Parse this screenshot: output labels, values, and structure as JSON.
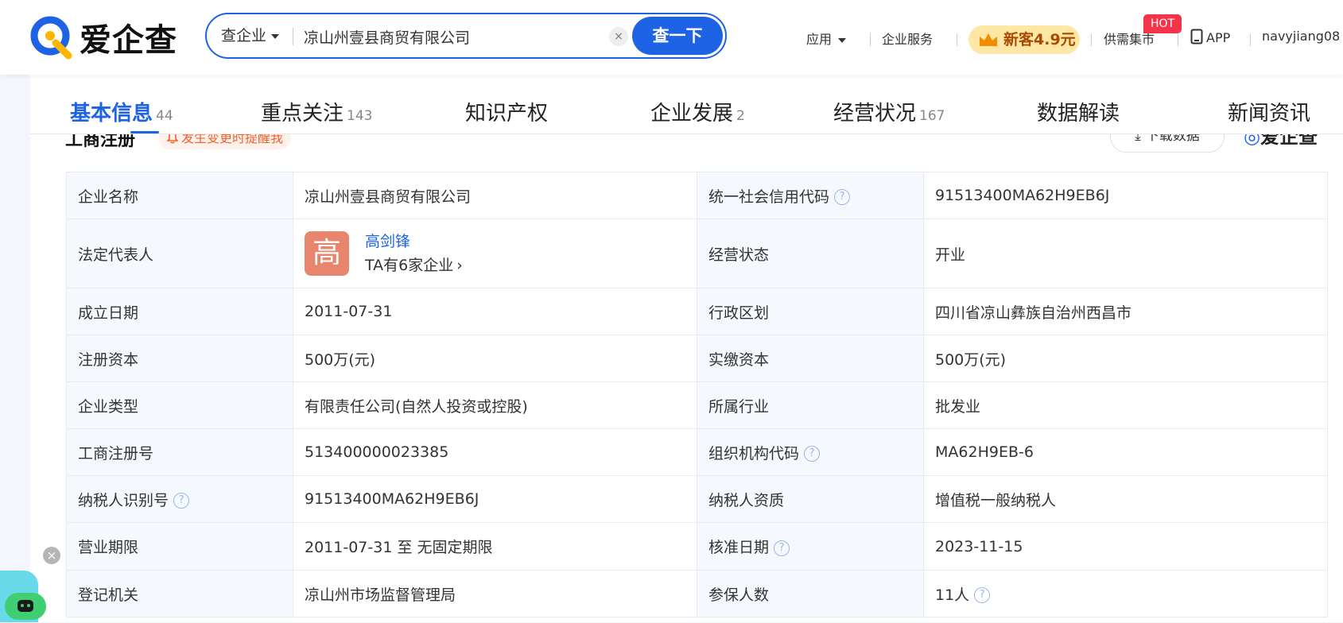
{
  "header": {
    "logo_text": "爱企查",
    "search": {
      "type_label": "查企业",
      "value": "凉山州壹县商贸有限公司",
      "clear_symbol": "×",
      "button_label": "查一下"
    },
    "nav": {
      "apps": "应用",
      "enterprise_services": "企业服务",
      "promo": "新客4.9元",
      "marketplace": "供需集市",
      "hot_badge": "HOT",
      "app": "APP",
      "user": "navyjiang08"
    }
  },
  "tabs": [
    {
      "label": "基本信息",
      "count": "44"
    },
    {
      "label": "重点关注",
      "count": "143"
    },
    {
      "label": "知识产权",
      "count": ""
    },
    {
      "label": "企业发展",
      "count": "2"
    },
    {
      "label": "经营状况",
      "count": "167"
    },
    {
      "label": "数据解读",
      "count": ""
    },
    {
      "label": "新闻资讯",
      "count": ""
    }
  ],
  "section": {
    "title": "工商注册",
    "remind": "发生变更时提醒我",
    "download": "下载数据",
    "watermark": "爱企查"
  },
  "info": {
    "company_name_label": "企业名称",
    "company_name": "凉山州壹县商贸有限公司",
    "credit_code_label": "统一社会信用代码",
    "credit_code": "91513400MA62H9EB6J",
    "legal_rep_label": "法定代表人",
    "legal_rep_avatar": "高",
    "legal_rep_name": "高剑锋",
    "legal_rep_companies": "TA有6家企业",
    "status_label": "经营状态",
    "status": "开业",
    "founded_label": "成立日期",
    "founded": "2011-07-31",
    "district_label": "行政区划",
    "district": "四川省凉山彝族自治州西昌市",
    "reg_capital_label": "注册资本",
    "reg_capital": "500万(元)",
    "paid_capital_label": "实缴资本",
    "paid_capital": "500万(元)",
    "type_label": "企业类型",
    "type": "有限责任公司(自然人投资或控股)",
    "industry_label": "所属行业",
    "industry": "批发业",
    "reg_no_label": "工商注册号",
    "reg_no": "513400000023385",
    "org_code_label": "组织机构代码",
    "org_code": "MA62H9EB-6",
    "taxpayer_id_label": "纳税人识别号",
    "taxpayer_id": "91513400MA62H9EB6J",
    "taxpayer_qual_label": "纳税人资质",
    "taxpayer_qual": "增值税一般纳税人",
    "term_label": "营业期限",
    "term": "2011-07-31 至 无固定期限",
    "approval_date_label": "核准日期",
    "approval_date": "2023-11-15",
    "authority_label": "登记机关",
    "authority": "凉山州市场监督管理局",
    "insured_label": "参保人数",
    "insured": "11人"
  },
  "colors": {
    "brand": "#1e62e6",
    "remind": "#f0622e",
    "avatar": "#e8866d",
    "hot": "#f5344a"
  }
}
